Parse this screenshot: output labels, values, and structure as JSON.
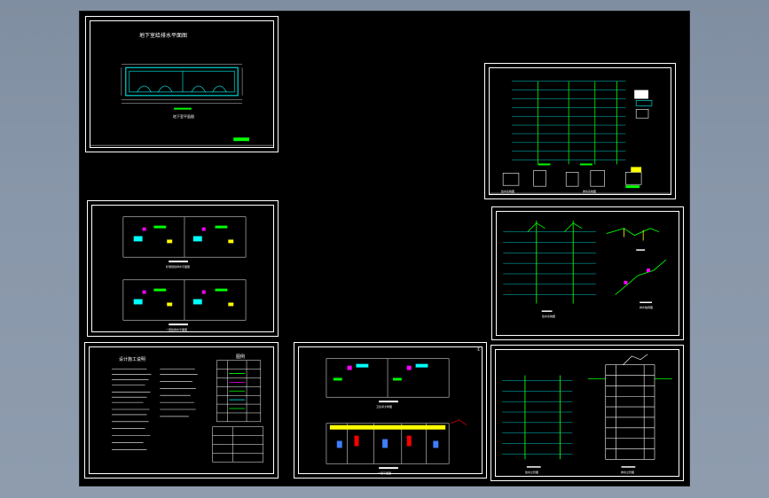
{
  "viewport": {
    "background": "#8897a9",
    "canvas": "#000000"
  },
  "sheets": [
    {
      "id": "basement-plan",
      "title": "地下室给排水平面图",
      "caption": "地下室平面图"
    },
    {
      "id": "system-diagrams-a",
      "caption_a": "给水系统图",
      "caption_b": "排水系统图"
    },
    {
      "id": "standard-floor-plans",
      "caption_a": "标准层给排水平面图",
      "caption_b": "一层给排水平面图"
    },
    {
      "id": "isometric-diagrams",
      "caption_a": "给水系统图",
      "caption_b": "排水轴测图"
    },
    {
      "id": "design-notes",
      "title": "设计施工说明",
      "legend_title": "图例"
    },
    {
      "id": "unit-plans",
      "number": "①",
      "caption_a": "卫生间大样图",
      "caption_b": "一层平面图"
    },
    {
      "id": "riser-diagrams",
      "caption_a": "给水立管图",
      "caption_b": "排水立管图"
    }
  ],
  "colors": {
    "line": "#ffffff",
    "cyan": "#00ffff",
    "green": "#00ff00",
    "yellow": "#ffff00",
    "magenta": "#ff00ff",
    "red": "#ff0000",
    "blue": "#3f7fff"
  }
}
